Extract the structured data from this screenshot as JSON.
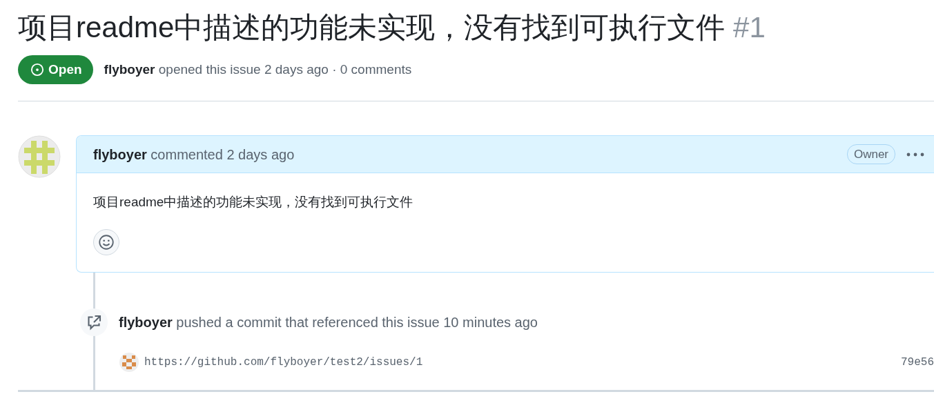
{
  "issue": {
    "title": "项目readme中描述的功能未实现，没有找到可执行文件",
    "number": "#1",
    "open": true,
    "state_label": "Open",
    "author": "flyboyer",
    "meta": "opened this issue 2 days ago · 0 comments"
  },
  "comment": {
    "author": "flyboyer",
    "action": "commented 2 days ago",
    "role": "Owner",
    "body": "项目readme中描述的功能未实现，没有找到可执行文件"
  },
  "event": {
    "author": "flyboyer",
    "action": "pushed a commit that referenced this issue 10 minutes ago",
    "commit_message": "https://github.com/flyboyer/test2/issues/1",
    "sha": "79e56"
  }
}
